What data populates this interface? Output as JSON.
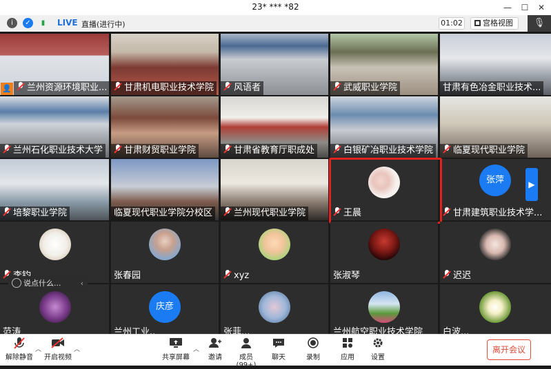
{
  "window": {
    "title": "23* *** *82"
  },
  "toolbar": {
    "live": "LIVE",
    "live_status": "直播(进行中)",
    "timer": "01:02",
    "view_mode": "宫格视图"
  },
  "host_badge": "👤",
  "tiles": [
    {
      "name": "兰州资源环境职业..."
    },
    {
      "name": "甘肃机电职业技术学院"
    },
    {
      "name": "风语者"
    },
    {
      "name": "武威职业学院"
    },
    {
      "name": "甘肃有色冶金职业技术..."
    },
    {
      "name": "兰州石化职业技术大学"
    },
    {
      "name": "甘肃财贸职业学院"
    },
    {
      "name": "甘肃省教育厅职成处"
    },
    {
      "name": "白银矿冶职业技术学院"
    },
    {
      "name": "临夏现代职业学院"
    },
    {
      "name": "培黎职业学院"
    },
    {
      "name": "临夏现代职业学院分校区"
    },
    {
      "name": "兰州现代职业学院"
    },
    {
      "name": "王晨"
    },
    {
      "name": "甘肃建筑职业技术学...",
      "avatar_text": "张萍"
    },
    {
      "name": "李钧"
    },
    {
      "name": "张春园"
    },
    {
      "name": "xyz"
    },
    {
      "name": "张淑琴"
    },
    {
      "name": "迟迟"
    },
    {
      "name": "范涛"
    },
    {
      "name": "兰州工业..",
      "avatar_text": "庆彦"
    },
    {
      "name": "张菲..."
    },
    {
      "name": "兰州航空职业技术学院"
    },
    {
      "name": "白波..."
    }
  ],
  "chat": {
    "placeholder": "说点什么..."
  },
  "bottom": {
    "unmute": "解除静音",
    "start_video": "开启视频",
    "share": "共享屏幕",
    "invite": "邀请",
    "members": "成员(99+)",
    "chat": "聊天",
    "record": "录制",
    "apps": "应用",
    "settings": "设置",
    "leave": "离开会议"
  },
  "colors": {
    "accent": "#1a7bf2",
    "highlight": "#e0231f",
    "leave": "#e04a3a",
    "host": "#f07f1b"
  }
}
